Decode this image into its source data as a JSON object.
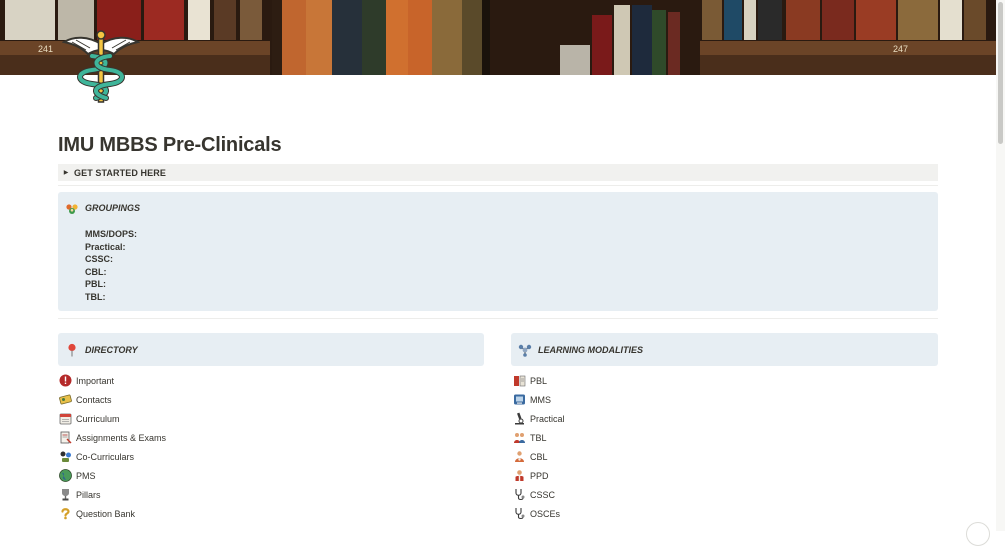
{
  "cover": {
    "shelf_numbers": [
      "241",
      "247"
    ]
  },
  "page": {
    "title": "IMU MBBS Pre-Clinicals"
  },
  "toggle": {
    "label": "GET STARTED HERE"
  },
  "groupings": {
    "title": "GROUPINGS",
    "icon": "group-icon",
    "lines": [
      "MMS/DOPS:",
      "Practical:",
      "CSSC:",
      "CBL:",
      "PBL:",
      "TBL:"
    ]
  },
  "directory": {
    "title": "DIRECTORY",
    "icon": "pushpin-icon",
    "items": [
      {
        "label": "Important",
        "icon": "important-icon"
      },
      {
        "label": "Contacts",
        "icon": "contacts-icon"
      },
      {
        "label": "Curriculum",
        "icon": "calendar-icon"
      },
      {
        "label": "Assignments & Exams",
        "icon": "assignment-icon"
      },
      {
        "label": "Co-Curriculars",
        "icon": "co-curricular-icon"
      },
      {
        "label": "PMS",
        "icon": "globe-icon"
      },
      {
        "label": "Pillars",
        "icon": "trophy-icon"
      },
      {
        "label": "Question Bank",
        "icon": "question-icon"
      }
    ]
  },
  "modalities": {
    "title": "LEARNING MODALITIES",
    "icon": "molecule-icon",
    "items": [
      {
        "label": "PBL",
        "icon": "pbl-icon"
      },
      {
        "label": "MMS",
        "icon": "mms-icon"
      },
      {
        "label": "Practical",
        "icon": "microscope-icon"
      },
      {
        "label": "TBL",
        "icon": "team-icon"
      },
      {
        "label": "CBL",
        "icon": "case-icon"
      },
      {
        "label": "PPD",
        "icon": "person-icon"
      },
      {
        "label": "CSSC",
        "icon": "stethoscope-icon"
      },
      {
        "label": "OSCEs",
        "icon": "exam-stethoscope-icon"
      }
    ]
  },
  "colors": {
    "callout_bg": "#e7eef3",
    "toggle_bg": "#f1f1ef",
    "text": "#37352f"
  }
}
